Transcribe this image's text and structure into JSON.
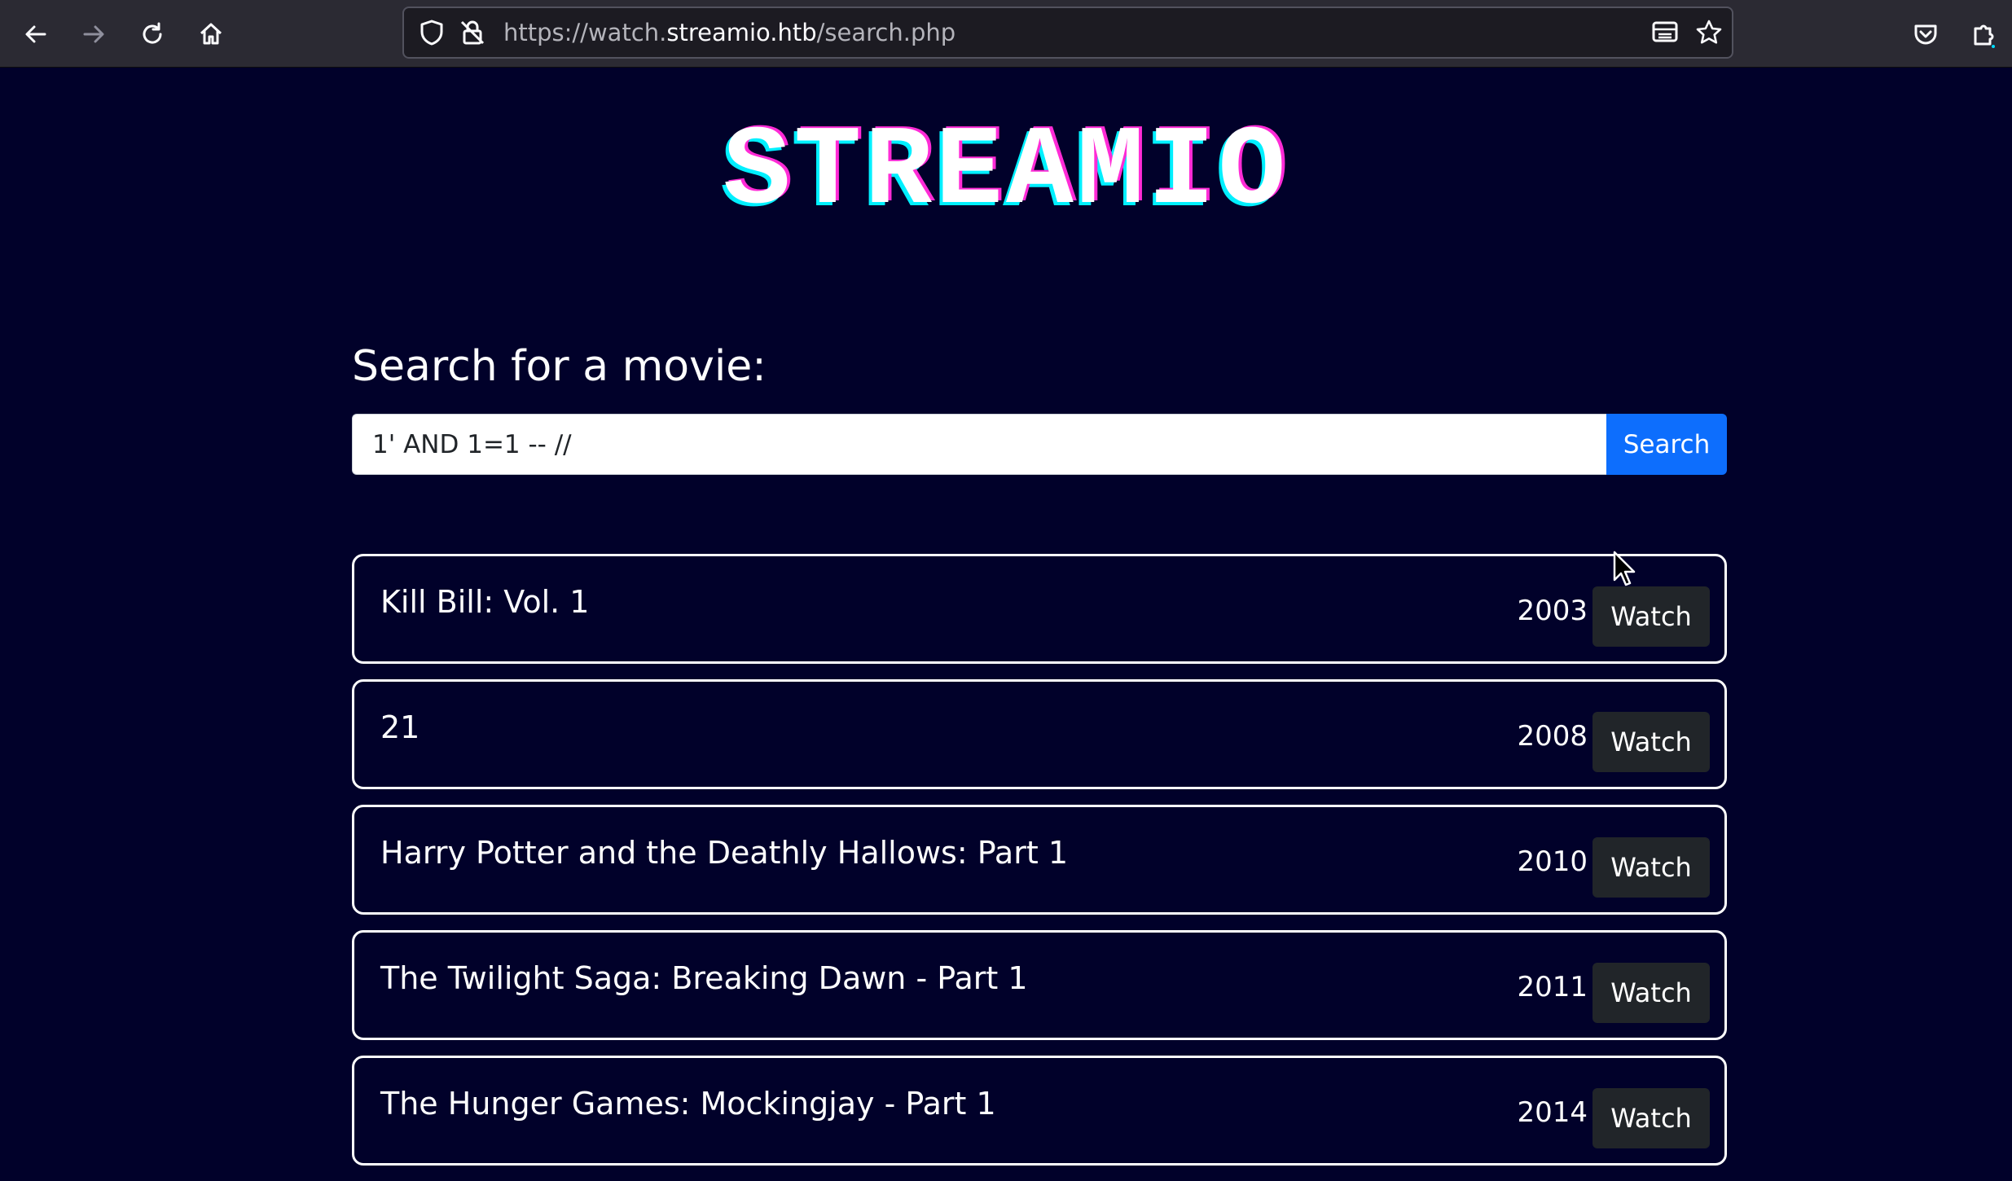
{
  "browser": {
    "url_prefix": "https://watch.",
    "url_domain": "streamio.htb",
    "url_path": "/search.php"
  },
  "site": {
    "logo_text": "STREAMIO"
  },
  "search": {
    "heading": "Search for a movie:",
    "query": "1' AND 1=1 -- //",
    "button_label": "Search"
  },
  "results": [
    {
      "title": "Kill Bill: Vol. 1",
      "year": "2003",
      "action": "Watch"
    },
    {
      "title": "21",
      "year": "2008",
      "action": "Watch"
    },
    {
      "title": "Harry Potter and the Deathly Hallows: Part 1",
      "year": "2010",
      "action": "Watch"
    },
    {
      "title": "The Twilight Saga: Breaking Dawn - Part 1",
      "year": "2011",
      "action": "Watch"
    },
    {
      "title": "The Hunger Games: Mockingjay - Part 1",
      "year": "2014",
      "action": "Watch"
    }
  ],
  "colors": {
    "page_bg": "#01012a",
    "primary_button": "#0d6efd",
    "watch_button": "#212529",
    "logo_pink": "#ff2bd6",
    "logo_cyan": "#00f0ff"
  }
}
